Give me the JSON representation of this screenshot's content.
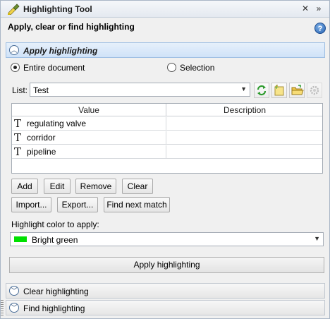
{
  "window": {
    "title": "Highlighting Tool",
    "icon": "highlighter-icon",
    "close_glyph": "✕",
    "dock_glyph": "»"
  },
  "header": {
    "subtitle": "Apply, clear or find highlighting",
    "help_glyph": "?"
  },
  "sections": {
    "apply": {
      "label": "Apply highlighting",
      "expanded": true
    },
    "clear": {
      "label": "Clear highlighting",
      "expanded": false
    },
    "find": {
      "label": "Find highlighting",
      "expanded": false
    }
  },
  "scope": {
    "options": [
      {
        "label": "Entire document",
        "checked": true
      },
      {
        "label": "Selection",
        "checked": false
      }
    ]
  },
  "list": {
    "label": "List:",
    "selected": "Test",
    "tools": [
      "refresh-icon",
      "new-list-icon",
      "open-folder-icon",
      "settings-icon"
    ]
  },
  "table": {
    "columns": [
      "Value",
      "Description"
    ],
    "rows": [
      {
        "value": "regulating valve",
        "description": ""
      },
      {
        "value": "corridor",
        "description": ""
      },
      {
        "value": "pipeline",
        "description": ""
      }
    ],
    "row_icon_glyph": "T"
  },
  "buttons": {
    "add": "Add",
    "edit": "Edit",
    "remove": "Remove",
    "clear": "Clear",
    "import": "Import...",
    "export": "Export...",
    "find_next": "Find next match",
    "apply": "Apply highlighting"
  },
  "color": {
    "label": "Highlight color to apply:",
    "selected": "Bright green",
    "swatch": "#00e000"
  },
  "colors": {
    "accent": "#cfe2f8",
    "border": "#a9b6c6"
  }
}
